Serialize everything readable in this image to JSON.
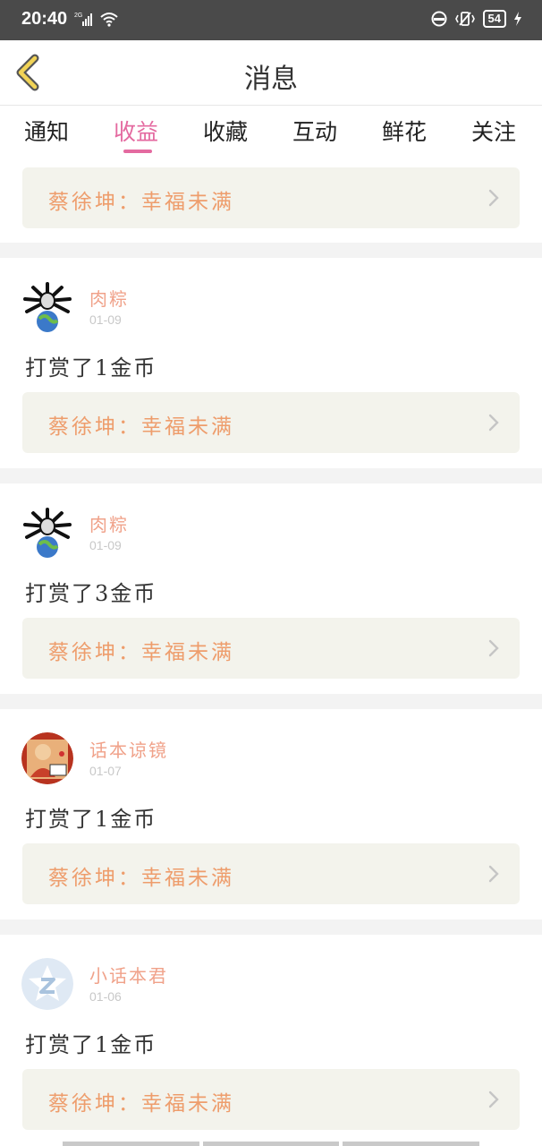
{
  "status": {
    "time": "20:40",
    "signal": "2G",
    "battery": "54"
  },
  "header": {
    "title": "消息"
  },
  "tabs": [
    {
      "label": "通知",
      "active": false
    },
    {
      "label": "收益",
      "active": true
    },
    {
      "label": "收藏",
      "active": false
    },
    {
      "label": "互动",
      "active": false
    },
    {
      "label": "鲜花",
      "active": false
    },
    {
      "label": "关注",
      "active": false
    }
  ],
  "colors": {
    "accent": "#e46aa0",
    "name": "#f0a28a",
    "link": "#ee9d6c",
    "link_bg": "#f3f3ec"
  },
  "partial_top": {
    "link": "蔡徐坤：幸福未满"
  },
  "messages": [
    {
      "avatar": "reaper-avatar",
      "name": "肉粽",
      "date": "01-09",
      "text": "打赏了1金币",
      "link": "蔡徐坤：幸福未满"
    },
    {
      "avatar": "reaper-avatar",
      "name": "肉粽",
      "date": "01-09",
      "text": "打赏了3金币",
      "link": "蔡徐坤：幸福未满"
    },
    {
      "avatar": "monk-avatar",
      "name": "话本谅镜",
      "date": "01-07",
      "text": "打赏了1金币",
      "link": "蔡徐坤：幸福未满"
    },
    {
      "avatar": "z-logo-avatar",
      "name": "小话本君",
      "date": "01-06",
      "text": "打赏了1金币",
      "link": "蔡徐坤：幸福未满"
    }
  ]
}
